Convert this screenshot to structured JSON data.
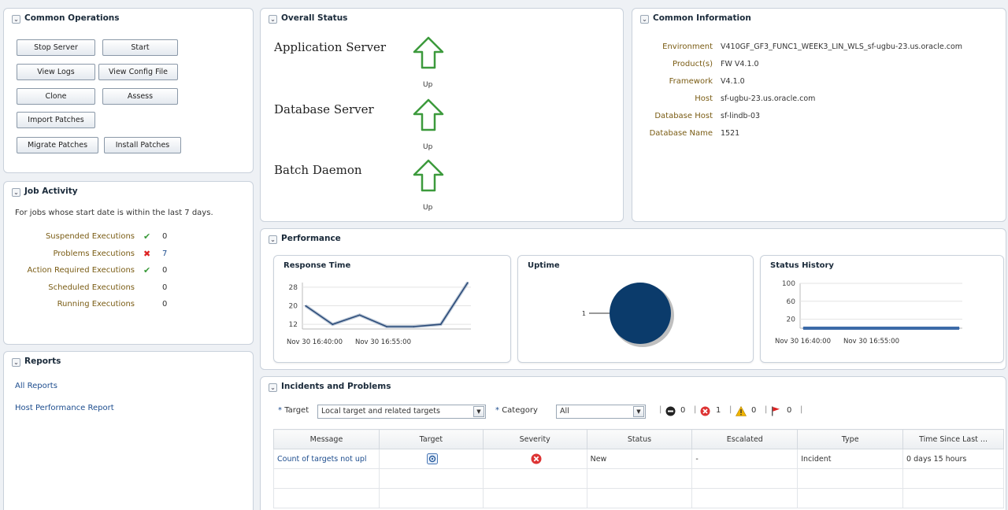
{
  "common_operations": {
    "title": "Common Operations",
    "buttons": [
      "Stop Server",
      "Start",
      "View Logs",
      "View Config File",
      "Clone",
      "Assess",
      "Import Patches",
      "Migrate Patches",
      "Install Patches"
    ]
  },
  "job_activity": {
    "title": "Job Activity",
    "description": "For jobs whose start date is within the last 7 days.",
    "rows": [
      {
        "label": "Suspended Executions",
        "icon": "check",
        "value": "0"
      },
      {
        "label": "Problems Executions",
        "icon": "x",
        "value": "7"
      },
      {
        "label": "Action Required Executions",
        "icon": "check",
        "value": "0"
      },
      {
        "label": "Scheduled Executions",
        "icon": "",
        "value": "0"
      },
      {
        "label": "Running Executions",
        "icon": "",
        "value": "0"
      }
    ]
  },
  "reports": {
    "title": "Reports",
    "links": [
      "All Reports",
      "Host Performance Report"
    ]
  },
  "overall_status": {
    "title": "Overall Status",
    "items": [
      {
        "name": "Application Server",
        "status": "Up"
      },
      {
        "name": "Database Server",
        "status": "Up"
      },
      {
        "name": "Batch Daemon",
        "status": "Up"
      }
    ]
  },
  "common_information": {
    "title": "Common Information",
    "fields": [
      {
        "label": "Environment",
        "value": "V410GF_GF3_FUNC1_WEEK3_LIN_WLS_sf-ugbu-23.us.oracle.com"
      },
      {
        "label": "Product(s)",
        "value": "FW V4.1.0"
      },
      {
        "label": "Framework",
        "value": "V4.1.0"
      },
      {
        "label": "Host",
        "value": "sf-ugbu-23.us.oracle.com"
      },
      {
        "label": "Database Host",
        "value": "sf-lindb-03"
      },
      {
        "label": "Database Name",
        "value": "1521"
      }
    ]
  },
  "performance": {
    "title": "Performance",
    "response_time": {
      "title": "Response Time",
      "x_labels": [
        "Nov 30 16:40:00",
        "Nov 30 16:55:00"
      ]
    },
    "uptime": {
      "title": "Uptime",
      "label": "1"
    },
    "status_history": {
      "title": "Status History",
      "x_labels": [
        "Nov 30 16:40:00",
        "Nov 30 16:55:00"
      ]
    }
  },
  "chart_data": [
    {
      "type": "line",
      "title": "Response Time",
      "ylim": [
        10,
        30
      ],
      "yticks": [
        "28",
        "20",
        "12"
      ],
      "x_labels": [
        "Nov 30 16:40:00",
        "Nov 30 16:55:00"
      ],
      "values": [
        20,
        12,
        16,
        11,
        11,
        12,
        30
      ]
    },
    {
      "type": "pie",
      "title": "Uptime",
      "slices": [
        {
          "label": "1",
          "value": 1
        }
      ],
      "color": "#0b3b6b"
    },
    {
      "type": "line",
      "title": "Status History",
      "ylim": [
        0,
        100
      ],
      "yticks": [
        "100",
        "60",
        "20"
      ],
      "x_labels": [
        "Nov 30 16:40:00",
        "Nov 30 16:55:00"
      ],
      "values": [
        0,
        0
      ]
    }
  ],
  "incidents": {
    "title": "Incidents and Problems",
    "target_label": "Target",
    "target_value": "Local target and related targets",
    "category_label": "Category",
    "category_value": "All",
    "counts": [
      "0",
      "1",
      "0",
      "0"
    ],
    "columns": [
      "Message",
      "Target",
      "Severity",
      "Status",
      "Escalated",
      "Type",
      "Time Since Last ..."
    ],
    "rows": [
      {
        "message": "Count of targets not upl",
        "status": "New",
        "escalated": "-",
        "type": "Incident",
        "time": "0 days 15 hours"
      }
    ]
  },
  "colors": {
    "accent": "#1d4d8e",
    "arrow": "#3c9a3c",
    "pie": "#0b3b6b",
    "label": "#7a5c14"
  }
}
